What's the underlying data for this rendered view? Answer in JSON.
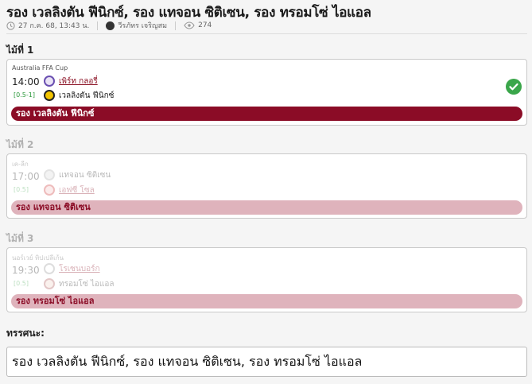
{
  "header": {
    "title": "รอง เวลลิงตัน ฟีนิกซ์, รอง แทจอน ซิติเซน, รอง ทรอมโซ่ ไอแอล",
    "date": "27 ก.ค. 68, 13:43 น.",
    "author": "วีรภัทร เจริญสม",
    "views": "274"
  },
  "pairs": [
    {
      "label": "ไม้ที่ 1",
      "league": "Australia FFA Cup",
      "time": "14:00",
      "handicap": "[0.5-1]",
      "team_home": "เพิร์ท กลอรี่",
      "team_away": "เวลลิงตัน ฟีนิกซ์",
      "pick": "รอง เวลลิงตัน ฟีนิกซ์",
      "status": "check-icon"
    },
    {
      "label": "ไม้ที่ 2",
      "league": "เค-ลีก",
      "time": "17:00",
      "handicap": "[0.5]",
      "team_home": "แทจอน ซิติเซน",
      "team_away": "เอฟซี โซล",
      "pick": "รอง แทจอน ซิติเซน"
    },
    {
      "label": "ไม้ที่ 3",
      "league": "นอร์เวย์ ทิปเปลีเก้น",
      "time": "19:30",
      "handicap": "[0.5]",
      "team_home": "โรเซนบอร์ก",
      "team_away": "ทรอมโซ่ ไอแอล",
      "pick": "รอง ทรอมโซ่ ไอแอล"
    }
  ],
  "summary": {
    "label": "ทรรศนะ:",
    "text": "รอง เวลลิงตัน ฟีนิกซ์, รอง แทจอน ซิติเซน, รอง ทรอมโซ่ ไอแอล"
  },
  "colors": {
    "pick_bar": "#8b0c26",
    "pick_bar_faded": "#dfb3bc",
    "handicap_green": "#2e9a3d",
    "check_green": "#3aa64a"
  }
}
